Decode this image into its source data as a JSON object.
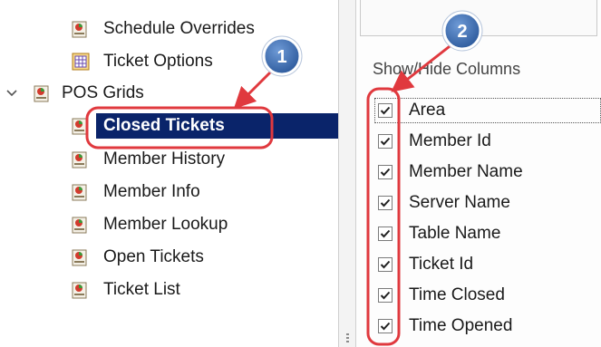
{
  "tree": {
    "items": [
      {
        "label": "Schedule Overrides",
        "icon": "report-icon"
      },
      {
        "label": "Ticket Options",
        "icon": "options-grid-icon"
      },
      {
        "label": "POS Grids",
        "icon": "report-icon"
      },
      {
        "label": "Closed Tickets",
        "icon": "report-icon",
        "selected": true
      },
      {
        "label": "Member History",
        "icon": "report-icon"
      },
      {
        "label": "Member Info",
        "icon": "report-icon"
      },
      {
        "label": "Member Lookup",
        "icon": "report-icon"
      },
      {
        "label": "Open Tickets",
        "icon": "report-icon"
      },
      {
        "label": "Ticket List",
        "icon": "report-icon"
      }
    ]
  },
  "panel": {
    "group_title": "Show/Hide Columns",
    "columns": [
      {
        "label": "Area",
        "checked": true
      },
      {
        "label": "Member Id",
        "checked": true
      },
      {
        "label": "Member Name",
        "checked": true
      },
      {
        "label": "Server Name",
        "checked": true
      },
      {
        "label": "Table Name",
        "checked": true
      },
      {
        "label": "Ticket Id",
        "checked": true
      },
      {
        "label": "Time Closed",
        "checked": true
      },
      {
        "label": "Time Opened",
        "checked": true
      }
    ]
  },
  "annotations": {
    "badge_1": "1",
    "badge_2": "2",
    "color": "#e0393e",
    "badge_fill": "#3f6fb0"
  },
  "colors": {
    "selection_bg": "#0a246a",
    "selection_text": "#ffffff"
  }
}
